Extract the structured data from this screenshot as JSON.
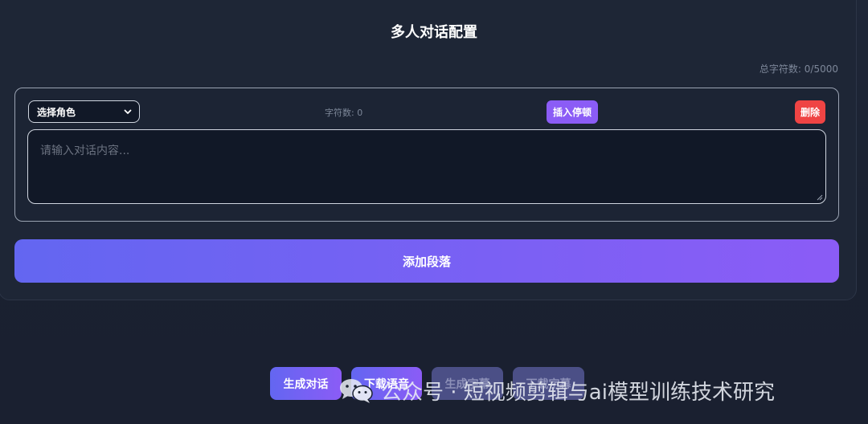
{
  "header": {
    "title": "多人对话配置",
    "total_count": "总字符数: 0/5000"
  },
  "segment": {
    "role_select_value": "选择角色",
    "char_count": "字符数: 0",
    "insert_pause_label": "插入停顿",
    "delete_label": "删除",
    "content_placeholder": "请输入对话内容..."
  },
  "actions": {
    "add_segment_label": "添加段落",
    "generate_label": "生成对话",
    "download_audio_label": "下载语音",
    "generate_subtitle_label": "生成字幕",
    "download_subtitle_label": "下载字幕"
  },
  "watermark": {
    "text": "公众号 · 短视频剪辑与ai模型训练技术研究",
    "icon": "wechat-icon"
  },
  "colors": {
    "accent": "#8b5cf6",
    "accent_start": "#6366f1",
    "danger": "#ef4444",
    "background": "#1b2231"
  }
}
